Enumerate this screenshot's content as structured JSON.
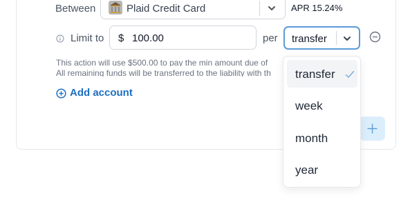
{
  "between": {
    "label": "Between",
    "account_name": "Plaid Credit Card",
    "apr": "APR 15.24%"
  },
  "limit": {
    "label": "Limit to",
    "currency": "$",
    "value": "100.00",
    "per_label": "per",
    "per_value": "transfer"
  },
  "help": {
    "line1": "This action will use $500.00 to pay the min amount due of",
    "line2": "All remaining funds will be transferred to the liability with th"
  },
  "add_account_label": "Add account",
  "dropdown": {
    "options": [
      "transfer",
      "week",
      "month",
      "year"
    ],
    "selected": "transfer"
  },
  "colors": {
    "accent": "#1d6fc2",
    "focus_border": "#5b9bd5",
    "plus_bg": "#dbeefc"
  }
}
